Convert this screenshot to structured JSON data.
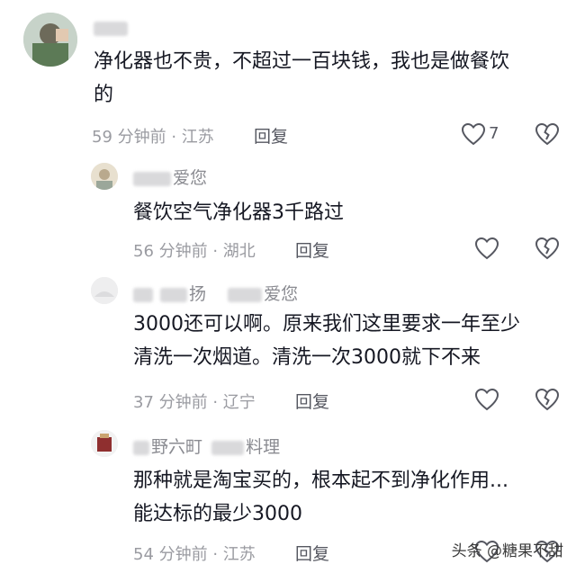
{
  "comments": [
    {
      "username_visible": "",
      "content_lines": [
        "净化器也不贵，不超过一百块钱，我也是做餐饮",
        "的"
      ],
      "time_location": "59 分钟前 · 江苏",
      "reply_label": "回复",
      "like_count": "7"
    },
    {
      "username_visible": "爱您",
      "content_lines": [
        "餐饮空气净化器3千路过"
      ],
      "time_location": "56 分钟前 · 湖北",
      "reply_label": "回复",
      "like_count": ""
    },
    {
      "username_visible_a": "扬",
      "username_visible_b": "爱您",
      "content_lines": [
        "3000还可以啊。原来我们这里要求一年至少",
        "清洗一次烟道。清洗一次3000就下不来"
      ],
      "time_location": "37 分钟前 · 辽宁",
      "reply_label": "回复",
      "like_count": ""
    },
    {
      "username_visible_a": "野六町",
      "username_visible_b": "料理",
      "content_lines": [
        "那种就是淘宝买的，根本起不到净化作用...",
        "能达标的最少3000"
      ],
      "time_location": "54 分钟前 · 江苏",
      "reply_label": "回复",
      "like_count": ""
    }
  ],
  "watermark": "头条 @糖果不甜",
  "icons": {
    "like": "heart-outline-icon",
    "dislike": "broken-heart-outline-icon"
  },
  "colors": {
    "text": "#161823",
    "meta": "#9a9ba1",
    "reply": "#555760"
  }
}
